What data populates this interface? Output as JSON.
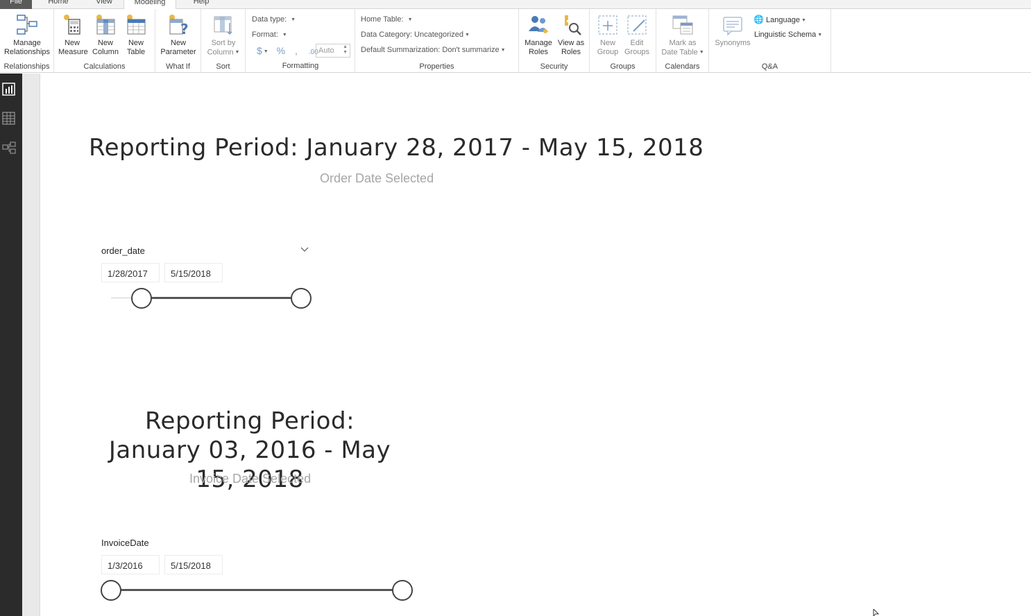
{
  "tabs": {
    "file": "File",
    "home": "Home",
    "view": "View",
    "modeling": "Modeling",
    "help": "Help"
  },
  "ribbon": {
    "relationships": {
      "group": "Relationships",
      "manage_line1": "Manage",
      "manage_line2": "Relationships"
    },
    "calculations": {
      "group": "Calculations",
      "new_measure_line1": "New",
      "new_measure_line2": "Measure",
      "new_column_line1": "New",
      "new_column_line2": "Column",
      "new_table_line1": "New",
      "new_table_line2": "Table"
    },
    "what_if": {
      "group": "What If",
      "new_parameter_line1": "New",
      "new_parameter_line2": "Parameter"
    },
    "sort": {
      "group": "Sort",
      "sort_line1": "Sort by",
      "sort_line2": "Column"
    },
    "formatting": {
      "group": "Formatting",
      "data_type": "Data type:",
      "format": "Format:",
      "currency": "$",
      "percent": "%",
      "comma": ",",
      "decimals": ".00",
      "auto": "Auto"
    },
    "properties": {
      "group": "Properties",
      "home_table": "Home Table:",
      "data_category": "Data Category: Uncategorized",
      "default_summarization": "Default Summarization: Don't summarize"
    },
    "security": {
      "group": "Security",
      "manage_roles_line1": "Manage",
      "manage_roles_line2": "Roles",
      "view_as_line1": "View as",
      "view_as_line2": "Roles"
    },
    "groups": {
      "group": "Groups",
      "new_group_line1": "New",
      "new_group_line2": "Group",
      "edit_groups_line1": "Edit",
      "edit_groups_line2": "Groups"
    },
    "calendars": {
      "group": "Calendars",
      "mark_line1": "Mark as",
      "mark_line2": "Date Table"
    },
    "qa": {
      "group": "Q&A",
      "synonyms": "Synonyms",
      "language": "Language",
      "linguistic_schema": "Linguistic Schema"
    }
  },
  "report": {
    "card1": {
      "title": "Reporting Period: January 28, 2017 - May 15, 2018",
      "subtitle": "Order Date Selected"
    },
    "slicer1": {
      "header": "order_date",
      "start": "1/28/2017",
      "end": "5/15/2018"
    },
    "card2": {
      "title": "Reporting Period: January 03, 2016 - May 15, 2018",
      "subtitle": "Invoice Date Selected"
    },
    "slicer2": {
      "header": "InvoiceDate",
      "start": "1/3/2016",
      "end": "5/15/2018"
    }
  },
  "icons": {
    "nav_report": "report-view-icon",
    "nav_data": "data-view-icon",
    "nav_model": "model-view-icon"
  },
  "colors": {
    "accent_blue": "#4a7ab5",
    "nav_bg": "#2b2b2b",
    "gold": "#e8b84a"
  }
}
